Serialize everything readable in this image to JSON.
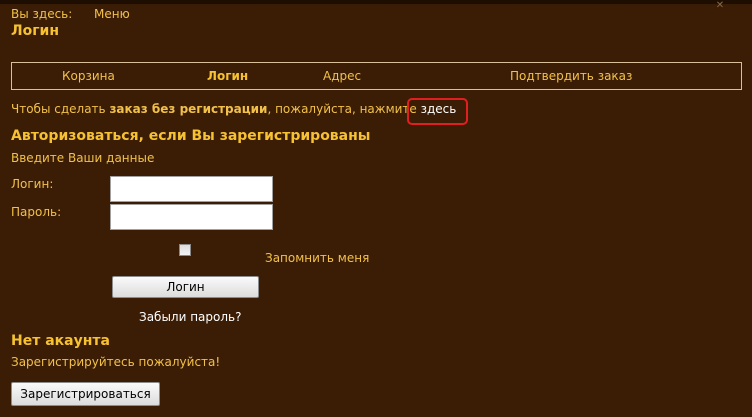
{
  "breadcrumb": {
    "prefix": "Вы здесь:",
    "menu_link": "Меню"
  },
  "page_title": "Логин",
  "steps": [
    {
      "label": "Корзина",
      "active": false
    },
    {
      "label": "Логин",
      "active": true
    },
    {
      "label": "Адрес",
      "active": false
    },
    {
      "label": "Подтвердить заказ",
      "active": false
    }
  ],
  "no_registration": {
    "text_before": "Чтобы сделать ",
    "bold_text": "заказ без регистрации",
    "text_after": ", пожалуйста, нажмите ",
    "link_text": "здесь"
  },
  "login_section": {
    "title": "Авторизоваться, если Вы зарегистрированы",
    "subtitle": "Введите Ваши данные",
    "login_label": "Логин:",
    "login_value": "",
    "password_label": "Пароль:",
    "password_value": "",
    "remember_label": "Запомнить меня",
    "remember_checked": false,
    "login_button": "Логин",
    "forgot_link": "Забыли пароль?"
  },
  "register_section": {
    "title": "Нет акаунта",
    "subtitle": "Зарегистрируйтесь пожалуйста!",
    "register_button": "Зарегистрироваться"
  },
  "colors": {
    "background": "#3b1d05",
    "text": "#f2c14a",
    "heading": "#f7c232",
    "link_white": "#ffffff",
    "highlight_red": "#e02020"
  },
  "icons": {
    "close": "close-icon"
  }
}
